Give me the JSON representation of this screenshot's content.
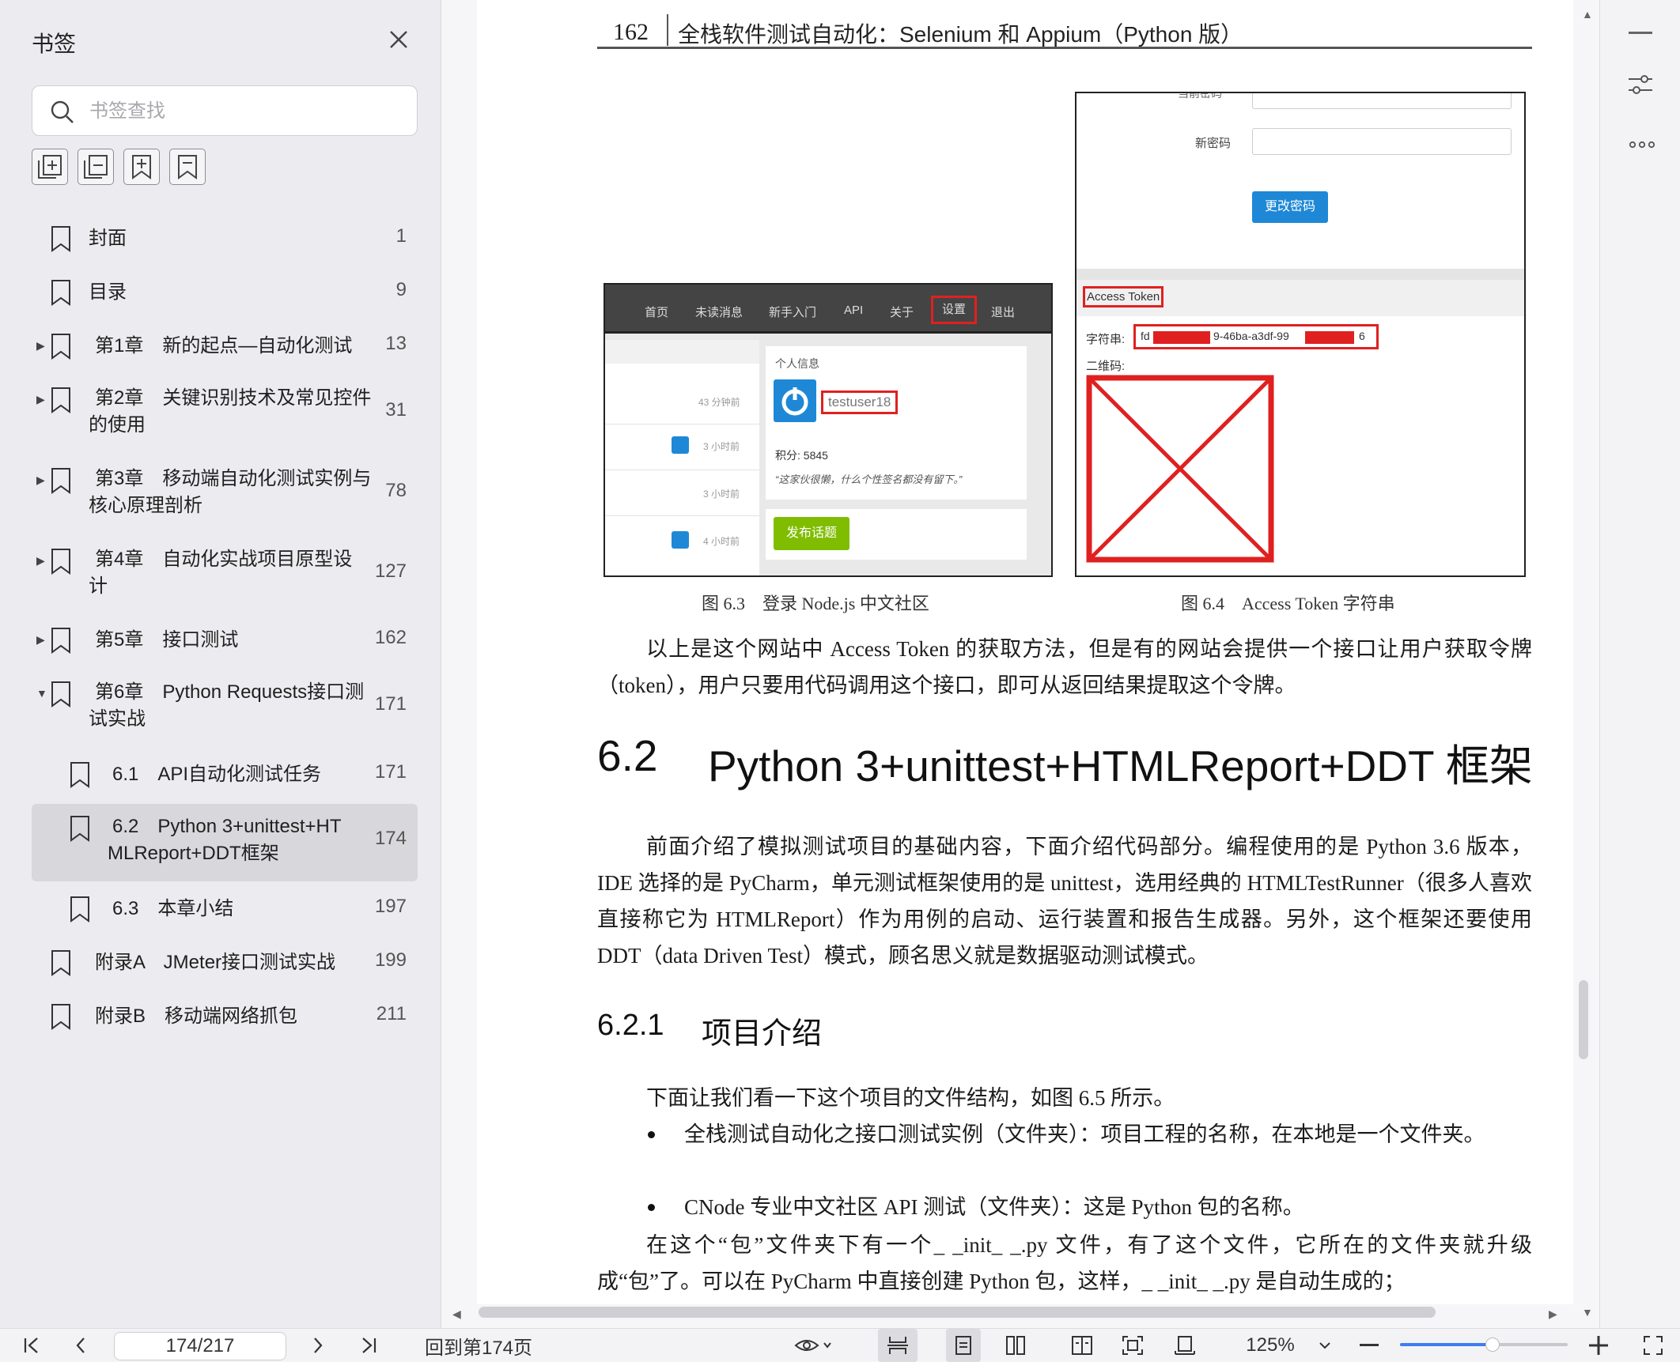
{
  "sidebar": {
    "title": "书签",
    "search_placeholder": "书签查找",
    "tools": [
      "expand-all-icon",
      "collapse-all-icon",
      "add-bookmark-icon",
      "bookmark-icon"
    ],
    "items": [
      {
        "label": "封面",
        "page": "1",
        "level": 0,
        "arrow": ""
      },
      {
        "label": "目录",
        "page": "9",
        "level": 0,
        "arrow": ""
      },
      {
        "label": "第1章　新的起点—自动化测试",
        "page": "13",
        "level": 0,
        "arrow": "▶"
      },
      {
        "label": "第2章　关键识别技术及常见控件",
        "label2": "的使用",
        "page": "31",
        "level": 0,
        "arrow": "▶"
      },
      {
        "label": "第3章　移动端自动化测试实例与",
        "label2": "核心原理剖析",
        "page": "78",
        "level": 0,
        "arrow": "▶"
      },
      {
        "label": "第4章　自动化实战项目原型设",
        "label2": "计",
        "page": "127",
        "level": 0,
        "arrow": "▶"
      },
      {
        "label": "第5章　接口测试",
        "page": "162",
        "level": 0,
        "arrow": "▶"
      },
      {
        "label": "第6章　Python Requests接口测",
        "label2": "试实战",
        "page": "171",
        "level": 0,
        "arrow": "▼"
      },
      {
        "label": "6.1　API自动化测试任务",
        "page": "171",
        "level": 1,
        "arrow": ""
      },
      {
        "label": "6.2　Python 3+unittest+HT",
        "label2": "MLReport+DDT框架",
        "page": "174",
        "level": 1,
        "arrow": ""
      },
      {
        "label": "6.3　本章小结",
        "page": "197",
        "level": 1,
        "arrow": ""
      },
      {
        "label": "附录A　JMeter接口测试实战",
        "page": "199",
        "level": 0,
        "arrow": ""
      },
      {
        "label": "附录B　移动端网络抓包",
        "page": "211",
        "level": 0,
        "arrow": ""
      }
    ]
  },
  "document": {
    "header_page": "162",
    "header_title": "全栈软件测试自动化：Selenium 和 Appium（Python 版）",
    "fig63": {
      "nav": [
        "首页",
        "未读消息",
        "新手入门",
        "API",
        "关于",
        "设置",
        "退出"
      ],
      "times": [
        "43 分钟前",
        "3 小时前",
        "3 小时前",
        "4 小时前"
      ],
      "profile_title": "个人信息",
      "username": "testuser18",
      "score": "积分: 5845",
      "quote": "“这家伙很懒，什么个性签名都没有留下。”",
      "post_button": "发布话题",
      "caption": "图 6.3　登录 Node.js 中文社区"
    },
    "fig64": {
      "label_current": "当前密码",
      "label_new": "新密码",
      "change_button": "更改密码",
      "access_token": "Access Token",
      "token_label": "字符串:",
      "token_prefix": "fd",
      "token_middle": "9-46ba-a3df-99",
      "token_suffix": "6",
      "qr_label": "二维码:",
      "caption": "图 6.4　Access Token 字符串"
    },
    "para1": "以上是这个网站中 Access Token 的获取方法，但是有的网站会提供一个接口让用户获取令牌（token），用户只要用代码调用这个接口，即可从返回结果提取这个令牌。",
    "h2_num": "6.2",
    "h2_text": "Python 3+unittest+HTMLReport+DDT 框架",
    "para2": "前面介绍了模拟测试项目的基础内容，下面介绍代码部分。编程使用的是 Python 3.6 版本，IDE 选择的是 PyCharm，单元测试框架使用的是 unittest，选用经典的 HTMLTestRunner（很多人喜欢直接称它为 HTMLReport）作为用例的启动、运行装置和报告生成器。另外，这个框架还要使用 DDT（data Driven Test）模式，顾名思义就是数据驱动测试模式。",
    "h3_num": "6.2.1",
    "h3_text": "项目介绍",
    "para3": "下面让我们看一下这个项目的文件结构，如图 6.5 所示。",
    "bullet1": "全栈测试自动化之接口测试实例（文件夹）：项目工程的名称，在本地是一个文件夹。",
    "bullet2": "CNode 专业中文社区 API 测试（文件夹）：这是 Python 包的名称。",
    "para4": "在这个“包”文件夹下有一个_ _init_ _.py 文件，有了这个文件，它所在的文件夹就升级成“包”了。可以在 PyCharm 中直接创建 Python 包，这样，_ _init_ _.py 是自动生成的；"
  },
  "bottombar": {
    "page_value": "174/217",
    "goto_label": "回到第174页",
    "zoom": "125%",
    "zoom_level": 0.55
  },
  "colors": {
    "accent": "#3c7df2",
    "red": "#e02020",
    "green": "#80bd01",
    "nav_dark": "#444444"
  }
}
